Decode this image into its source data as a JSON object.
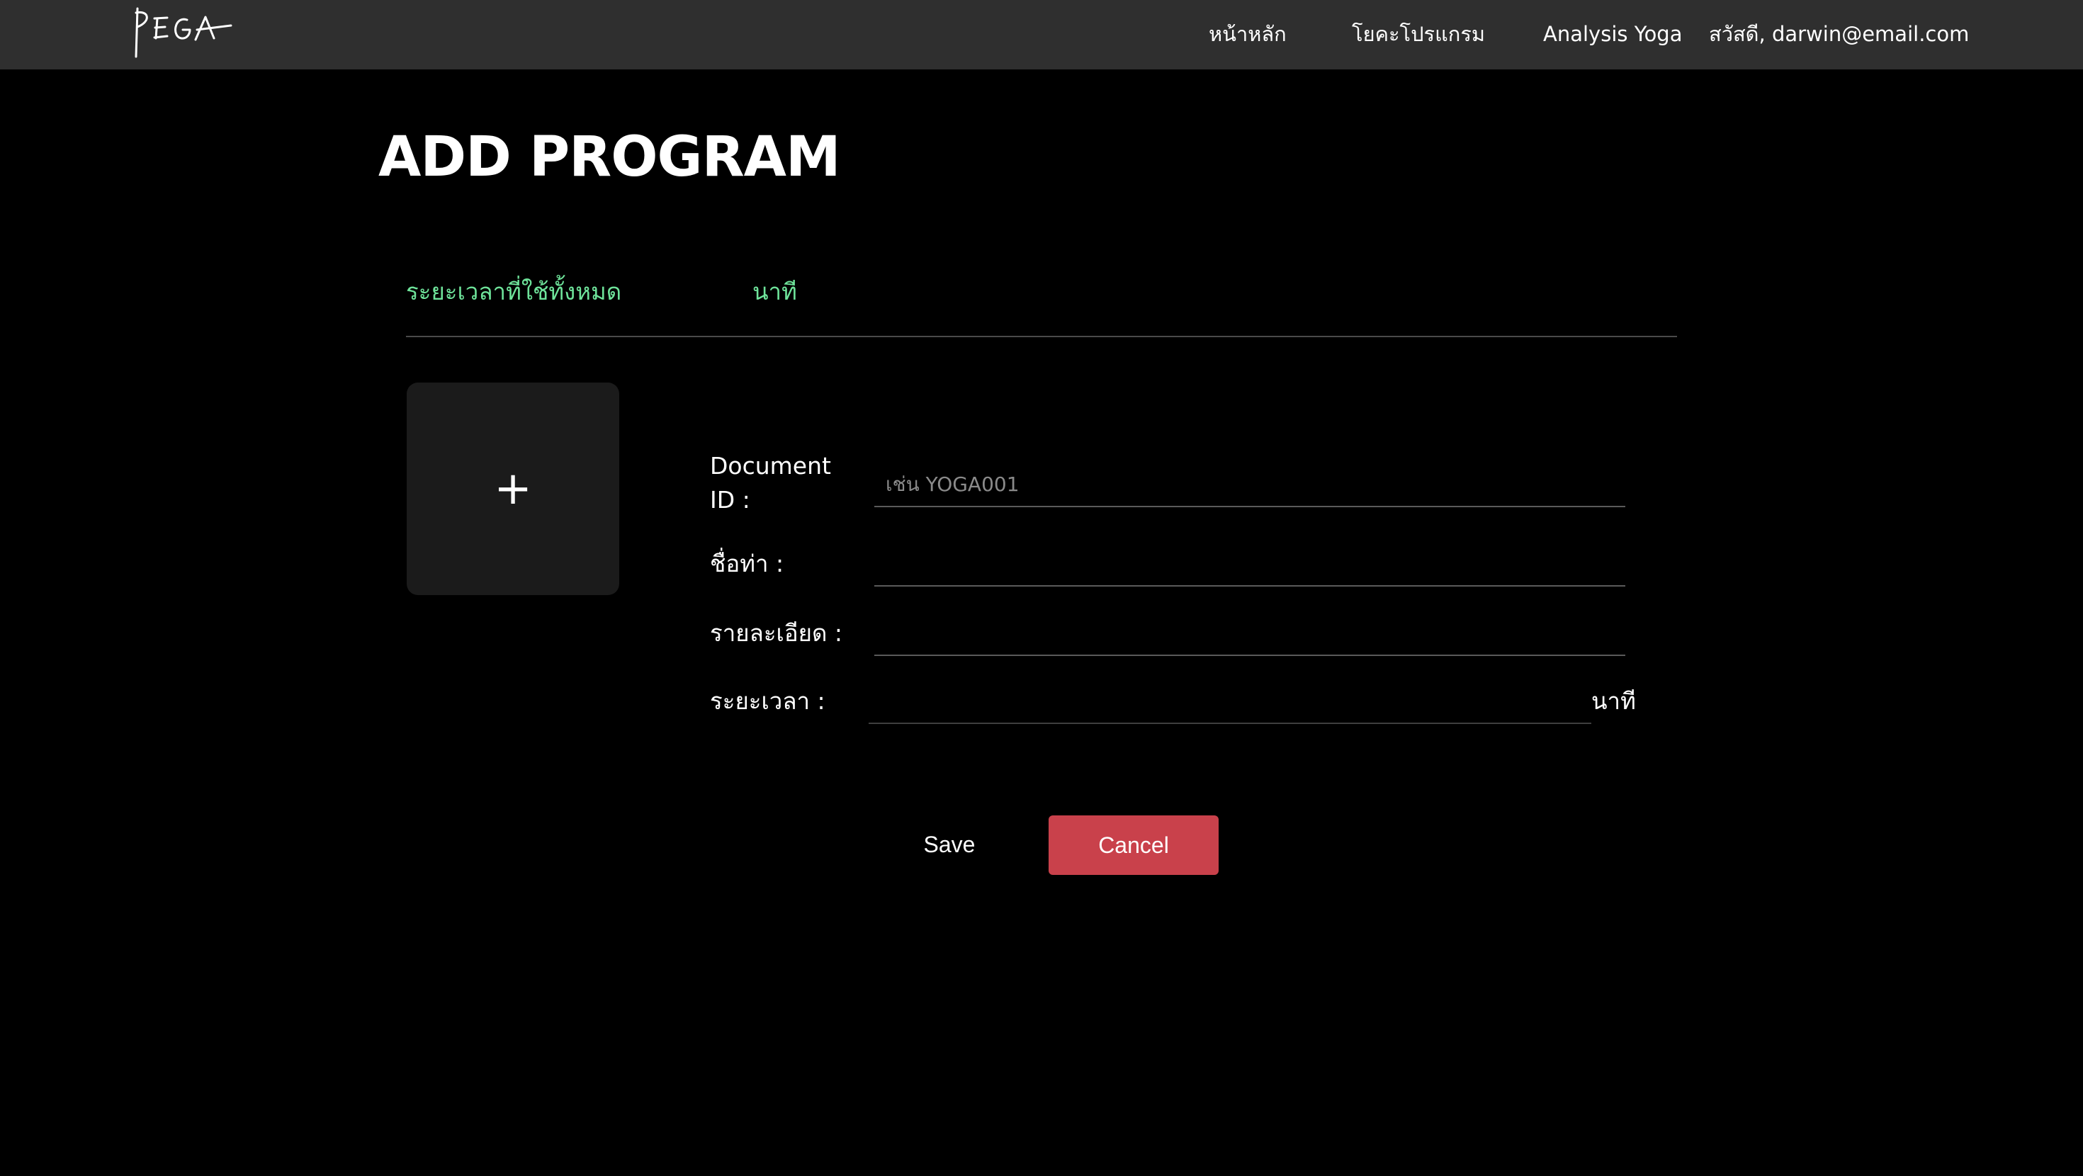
{
  "nav": {
    "logo_text": "PEGA",
    "home": "หน้าหลัก",
    "programs": "โยคะโปรแกรม",
    "analysis": "Analysis Yoga",
    "user_greeting": "สวัสดี, darwin@email.com"
  },
  "page": {
    "title": "ADD PROGRAM"
  },
  "summary": {
    "total_label": "ระยะเวลาที่ใช้ทั้งหมด",
    "total_value": "",
    "total_unit": "นาที"
  },
  "upload": {
    "icon": "plus-icon",
    "symbol": "+"
  },
  "form": {
    "document_id_label": "Document ID :",
    "document_id_value": "",
    "document_id_placeholder": "เช่น YOGA001",
    "pose_name_label": "ชื่อท่า :",
    "pose_name_value": "",
    "detail_label": "รายละเอียด :",
    "detail_value": "",
    "duration_label": "ระยะเวลา :",
    "duration_value": "",
    "duration_unit": "นาที"
  },
  "actions": {
    "save_label": "Save",
    "cancel_label": "Cancel"
  },
  "colors": {
    "background": "#000000",
    "navbar": "#2f2f2f",
    "accent_green": "#6ee39a",
    "cancel_red": "#c9414b",
    "tile": "#1b1b1b"
  }
}
